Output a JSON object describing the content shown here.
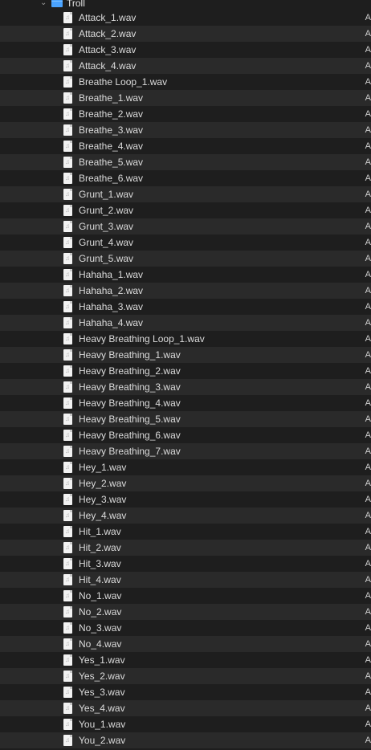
{
  "folder": {
    "name": "Troll",
    "expanded": true,
    "icon": "folder-icon",
    "color": "#4aa3ff"
  },
  "edge_text": "A",
  "files": [
    "Attack_1.wav",
    "Attack_2.wav",
    "Attack_3.wav",
    "Attack_4.wav",
    "Breathe Loop_1.wav",
    "Breathe_1.wav",
    "Breathe_2.wav",
    "Breathe_3.wav",
    "Breathe_4.wav",
    "Breathe_5.wav",
    "Breathe_6.wav",
    "Grunt_1.wav",
    "Grunt_2.wav",
    "Grunt_3.wav",
    "Grunt_4.wav",
    "Grunt_5.wav",
    "Hahaha_1.wav",
    "Hahaha_2.wav",
    "Hahaha_3.wav",
    "Hahaha_4.wav",
    "Heavy Breathing Loop_1.wav",
    "Heavy Breathing_1.wav",
    "Heavy Breathing_2.wav",
    "Heavy Breathing_3.wav",
    "Heavy Breathing_4.wav",
    "Heavy Breathing_5.wav",
    "Heavy Breathing_6.wav",
    "Heavy Breathing_7.wav",
    "Hey_1.wav",
    "Hey_2.wav",
    "Hey_3.wav",
    "Hey_4.wav",
    "Hit_1.wav",
    "Hit_2.wav",
    "Hit_3.wav",
    "Hit_4.wav",
    "No_1.wav",
    "No_2.wav",
    "No_3.wav",
    "No_4.wav",
    "Yes_1.wav",
    "Yes_2.wav",
    "Yes_3.wav",
    "Yes_4.wav",
    "You_1.wav",
    "You_2.wav"
  ]
}
